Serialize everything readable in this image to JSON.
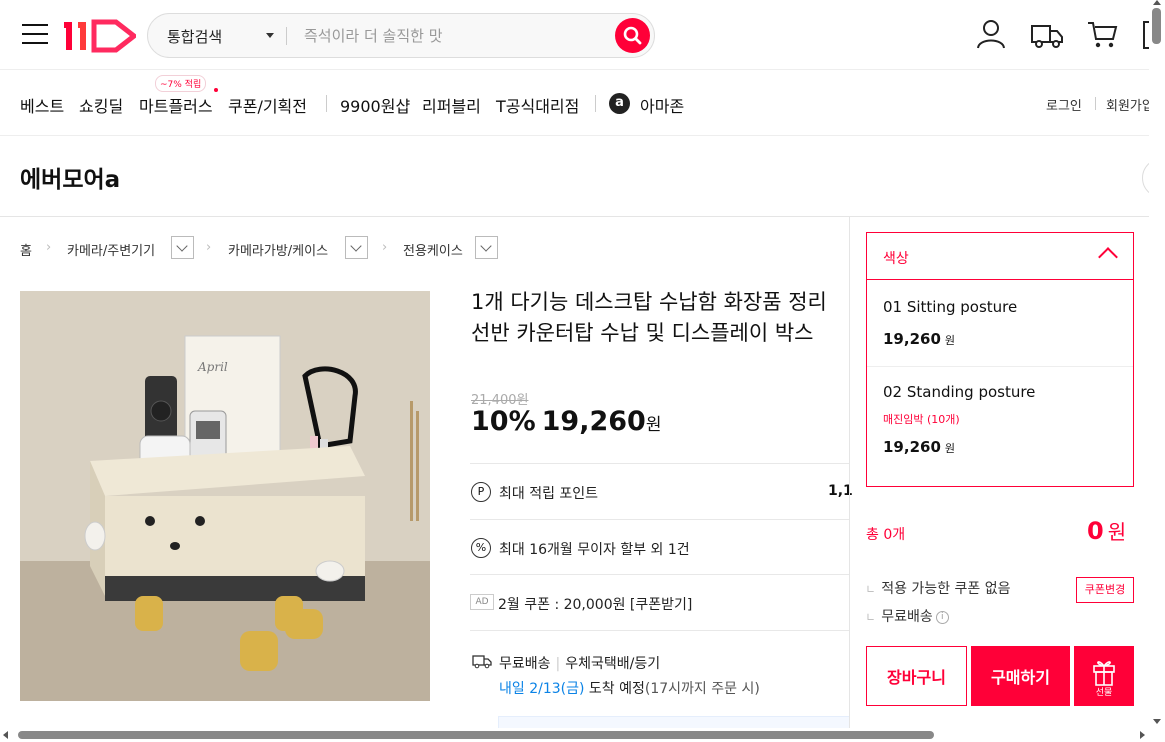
{
  "header": {
    "search_scope": "통합검색",
    "search_placeholder": "즉석이라 더 솔직한 맛"
  },
  "gnb": {
    "items": [
      "베스트",
      "쇼킹딜",
      "마트플러스",
      "쿠폰/기획전",
      "9900원샵",
      "리퍼블리",
      "T공식대리점",
      "아마존"
    ],
    "badge": "~7% 적립",
    "amazon_letter": "a",
    "login": "로그인",
    "signup": "회원가입"
  },
  "seller": {
    "name": "에버모어a"
  },
  "breadcrumb": [
    "홈",
    "카메라/주변기기",
    "카메라가방/케이스",
    "전용케이스"
  ],
  "product": {
    "image_text": "April",
    "title": "1개 다기능 데스크탑 수납함 화장품 정리 선반 카운터탑 수납 및 디스플레이 박스",
    "original_price": "21,400원",
    "discount": "10%",
    "price": "19,260",
    "price_unit": "원",
    "point_icon": "P",
    "point_label": "최대 적립 포인트",
    "point_value": "1,1",
    "installment_icon": "%",
    "installment": "최대 16개월 무이자 할부 외 1건",
    "ad_badge": "AD",
    "coupon": "2월 쿠폰 : 20,000원 [쿠폰받기]",
    "shipping_free": "무료배송",
    "shipping_method": "우체국택배/등기",
    "arrival_date": "내일 2/13(금)",
    "arrival_text": "도착 예정",
    "arrival_note": "(17시까지 주문 시)"
  },
  "options": {
    "label": "색상",
    "items": [
      {
        "name": "01 Sitting posture",
        "stock": "",
        "price": "19,260",
        "unit": "원"
      },
      {
        "name": "02 Standing posture",
        "stock": "매진임박 (10개)",
        "price": "19,260",
        "unit": "원"
      }
    ]
  },
  "summary": {
    "total_label": "총 0개",
    "total_amount": "0",
    "total_unit": "원",
    "coupon_status": "적용 가능한 쿠폰 없음",
    "coupon_change": "쿠폰변경",
    "free_shipping": "무료배송",
    "info_mark": "i"
  },
  "actions": {
    "cart": "장바구니",
    "buy": "구매하기",
    "gift": "선물"
  },
  "colors": {
    "accent": "#ff0038",
    "link_blue": "#0b83e6"
  }
}
